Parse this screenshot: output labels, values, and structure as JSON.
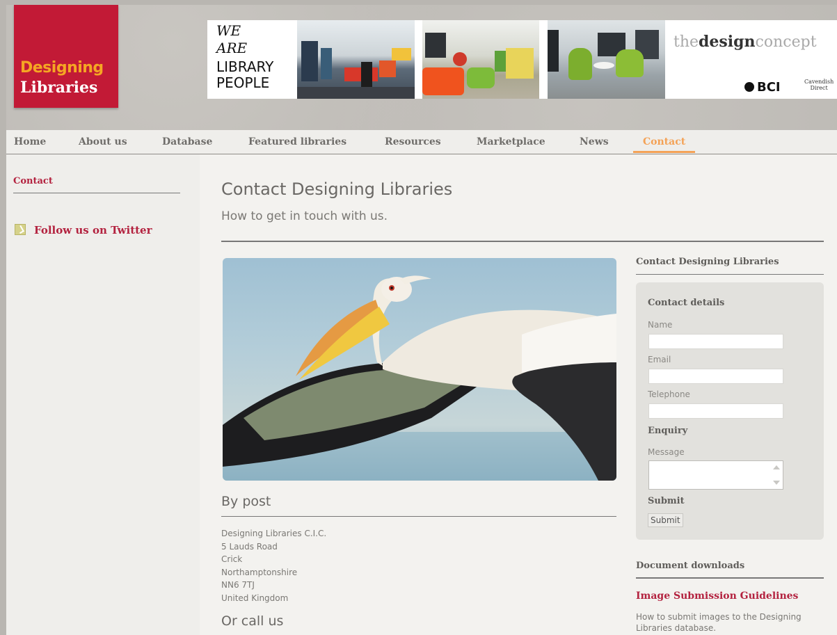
{
  "brand": {
    "logo_line1": "Designing",
    "logo_line2": "Libraries"
  },
  "banner": {
    "we_are": [
      "WE",
      "ARE",
      "LIBRARY",
      "PEOPLE"
    ],
    "design_concept_prefix": "the",
    "design_concept_bold": "design",
    "design_concept_suffix": "concept",
    "bci": "BCI",
    "cavendish": [
      "Cavendish",
      "Direct"
    ]
  },
  "nav": {
    "items": [
      "Home",
      "About us",
      "Database",
      "Featured libraries",
      "Resources",
      "Marketplace",
      "News",
      "Contact"
    ],
    "active": "Contact"
  },
  "sidebar": {
    "title": "Contact",
    "twitter": "Follow us on Twitter"
  },
  "main": {
    "title": "Contact Designing Libraries",
    "subtitle": "How to get in touch with us.",
    "by_post": "By post",
    "address": [
      "Designing Libraries C.I.C.",
      "5 Lauds Road",
      "Crick",
      "Northamptonshire",
      "NN6 7TJ",
      "United Kingdom"
    ],
    "or_call": "Or call us"
  },
  "contact_panel": {
    "title": "Contact Designing Libraries",
    "details_heading": "Contact details",
    "name_label": "Name",
    "email_label": "Email",
    "telephone_label": "Telephone",
    "enquiry_heading": "Enquiry",
    "message_label": "Message",
    "submit_heading": "Submit",
    "submit_button": "Submit"
  },
  "downloads": {
    "title": "Document downloads",
    "link": "Image Submission Guidelines",
    "description": "How to submit images to the Designing Libraries database."
  },
  "colors": {
    "brand_red": "#c21a36",
    "brand_orange": "#f5a623",
    "link": "#b3223f",
    "nav_active": "#f4a256"
  }
}
